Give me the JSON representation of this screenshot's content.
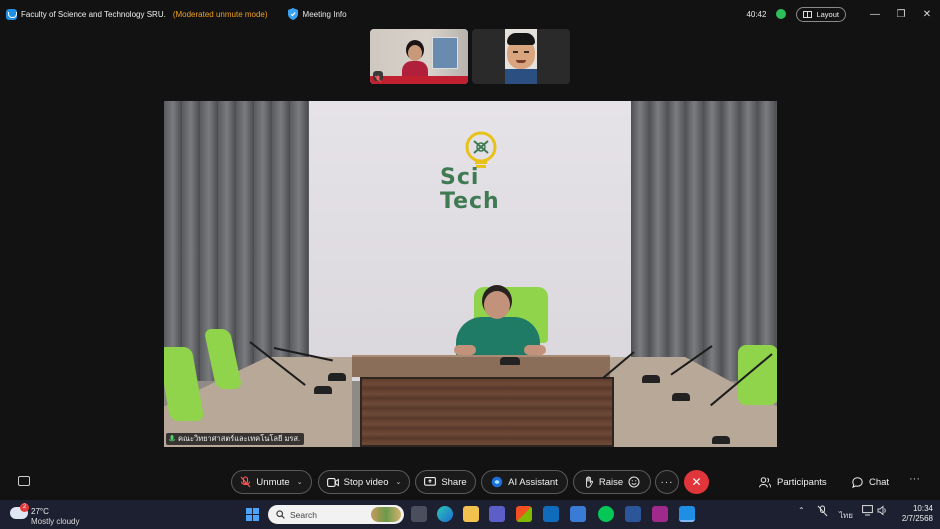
{
  "titlebar": {
    "meeting_title": "Faculty of Science and Technology SRU.",
    "mode": "(Moderated unmute mode)",
    "meeting_info": "Meeting Info",
    "timer": "40:42",
    "layout_label": "Layout"
  },
  "stage": {
    "logo_line1": "Sci",
    "logo_line2": "Tech",
    "participant_name": "คณะวิทยาศาสตร์และเทคโนโลยี มรส."
  },
  "controls": {
    "unmute": "Unmute",
    "stop_video": "Stop video",
    "share": "Share",
    "ai_assistant": "AI Assistant",
    "raise": "Raise",
    "participants": "Participants",
    "chat": "Chat"
  },
  "taskbar": {
    "weather_badge": "2",
    "temperature": "27°C",
    "weather": "Mostly cloudy",
    "search_placeholder": "Search",
    "language": "ไทย",
    "time": "10:34",
    "date": "2/7/2568"
  },
  "colors": {
    "background": "#121212",
    "accent_mode": "#f0a020",
    "end_call": "#e0353b",
    "status_online": "#2fbf5a",
    "logo_green": "#3f7a52"
  }
}
